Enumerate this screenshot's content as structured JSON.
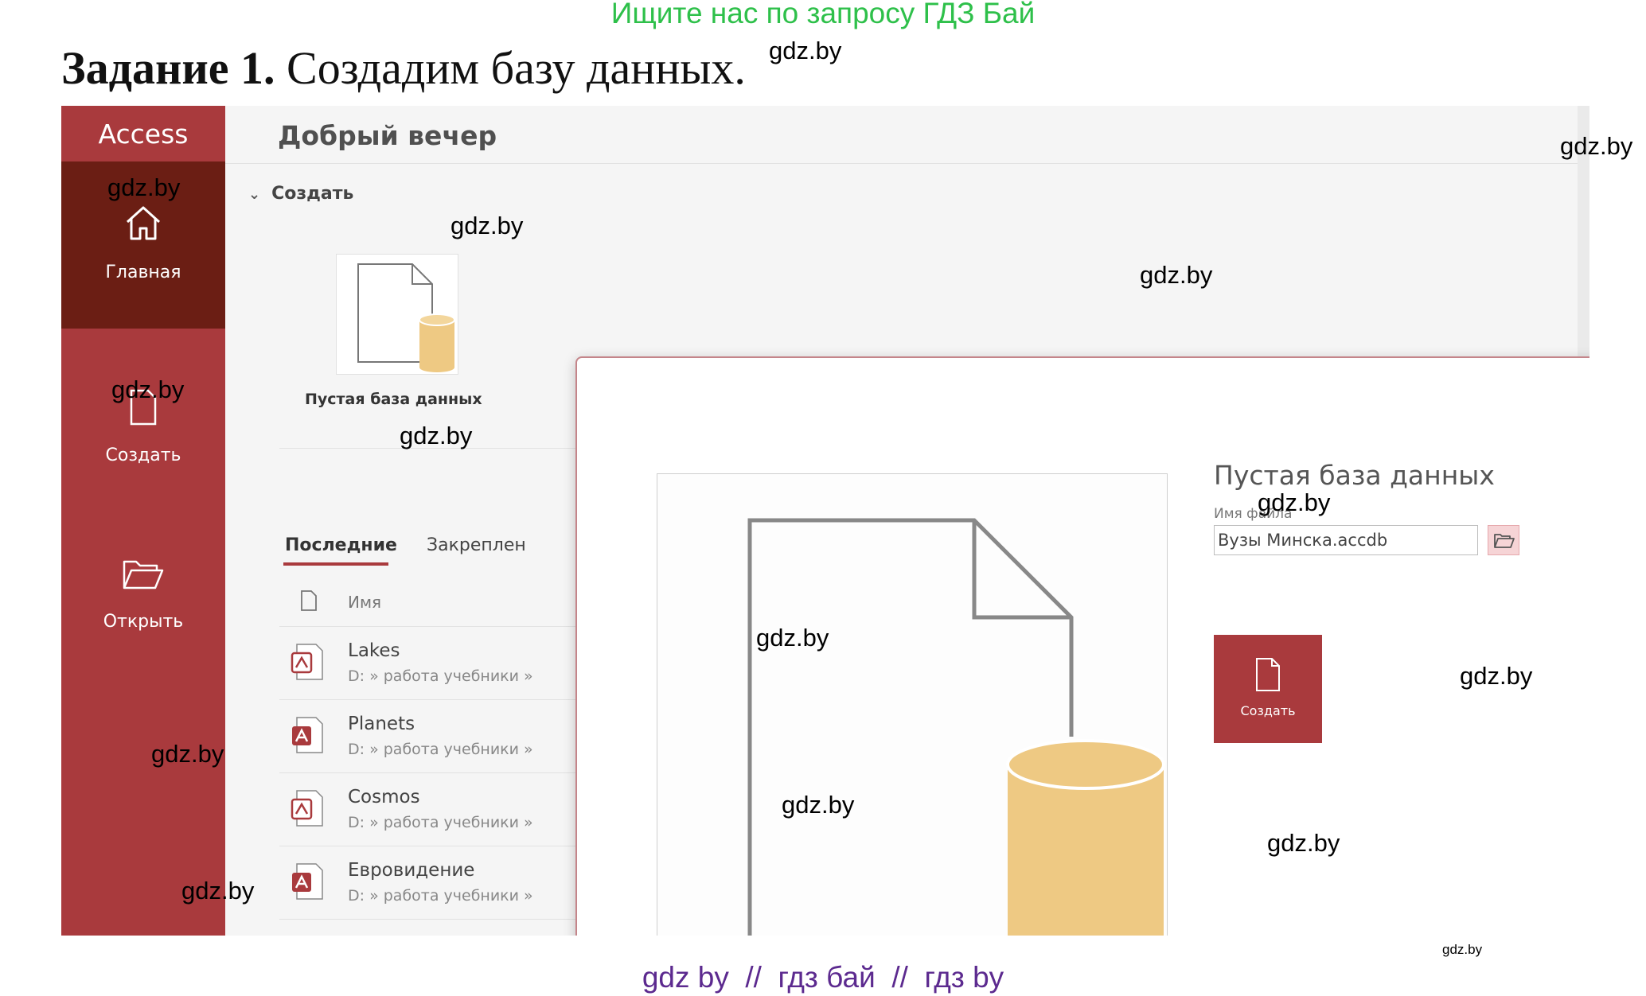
{
  "banner_top": "Ищите нас по запросу ГДЗ Бай",
  "task": {
    "bold": "Задание 1.",
    "text": "Создадим базу данных."
  },
  "access": {
    "brand": "Access",
    "nav": {
      "home": "Главная",
      "create": "Создать",
      "open": "Открыть"
    },
    "greeting": "Добрый вечер",
    "create_section": "Создать",
    "tile_label": "Пустая база данных",
    "tabs": {
      "recent": "Последние",
      "pinned": "Закреплен"
    },
    "column_name": "Имя",
    "files": [
      {
        "name": "Lakes",
        "path": "D: » работа учебники »",
        "icon": "access-db-form-icon"
      },
      {
        "name": "Planets",
        "path": "D: » работа учебники »",
        "icon": "access-db-icon"
      },
      {
        "name": "Cosmos",
        "path": "D: » работа учебники »",
        "icon": "access-db-form-icon"
      },
      {
        "name": "Евровидение",
        "path": "D: » работа учебники »",
        "icon": "access-db-icon"
      }
    ],
    "colors": {
      "accent": "#a93a3d",
      "active_nav": "#6b1e14"
    }
  },
  "dialog": {
    "title": "Пустая база данных",
    "filename_label": "Имя файла",
    "filename_value": "Вузы Минска.accdb",
    "create_button": "Создать",
    "close_icon": "close-icon",
    "browse_icon": "folder-open-icon"
  },
  "watermarks": [
    "gdz.by",
    "gdz.by",
    "gdz.by",
    "gdz.by",
    "gdz.by",
    "gdz.by",
    "gdz.by",
    "gdz.by",
    "gdz.by",
    "gdz.by",
    "gdz.by",
    "gdz.by",
    "gdz.by"
  ],
  "banner_bottom": "gdz by  //  гдз бай  //  гдз by"
}
